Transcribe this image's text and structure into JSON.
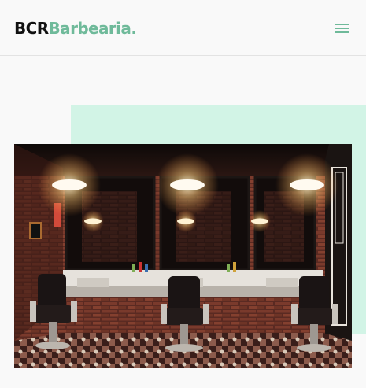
{
  "header": {
    "logo": {
      "part1": "BCR",
      "part2": "Barbearia."
    },
    "menu_icon": "hamburger-menu-icon"
  },
  "colors": {
    "brand_accent": "#6fba9a",
    "accent_block": "#d2f4e6",
    "logo_dark": "#111111",
    "background": "#f9f9f9"
  },
  "hero": {
    "image": "barbershop-interior-photo"
  }
}
